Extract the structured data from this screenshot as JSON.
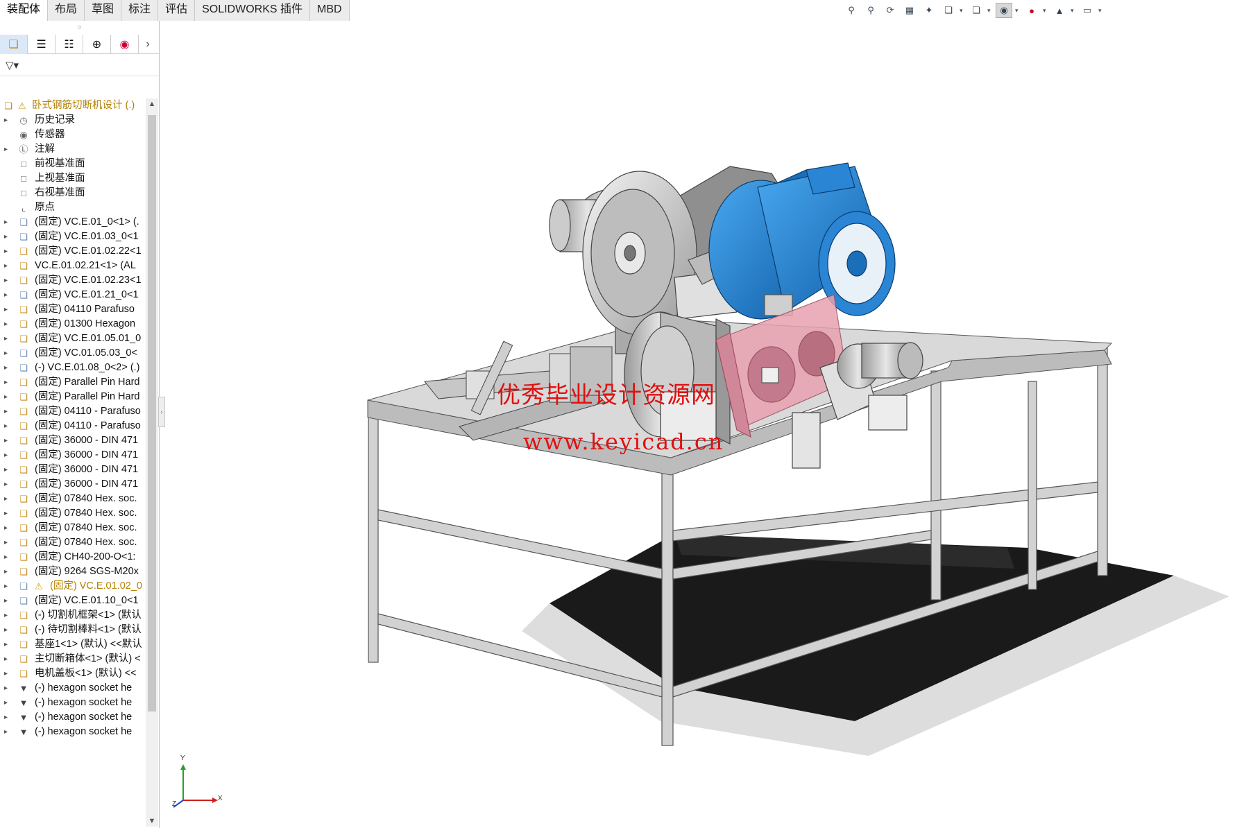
{
  "tabs": [
    {
      "label": "装配体",
      "active": true
    },
    {
      "label": "布局",
      "active": false
    },
    {
      "label": "草图",
      "active": false
    },
    {
      "label": "标注",
      "active": false
    },
    {
      "label": "评估",
      "active": false
    },
    {
      "label": "SOLIDWORKS 插件",
      "active": false
    },
    {
      "label": "MBD",
      "active": false
    }
  ],
  "hud_icons": [
    "zoom-to-fit-icon",
    "zoom-area-icon",
    "previous-view-icon",
    "section-view-icon",
    "dynamic-annotation-icon",
    "view-orientation-icon",
    "display-style-icon",
    "hide-show-icon",
    "edit-appearance-icon",
    "apply-scene-icon",
    "view-settings-icon"
  ],
  "panel_tabs": [
    "feature-manager-icon",
    "property-manager-icon",
    "configuration-manager-icon",
    "dimxpert-icon",
    "display-manager-icon"
  ],
  "tree": {
    "root_label": "卧式钢筋切断机设计 (.)",
    "items": [
      {
        "label": "历史记录",
        "icon": "history-icon",
        "arrow": true
      },
      {
        "label": "传感器",
        "icon": "sensor-icon",
        "arrow": false
      },
      {
        "label": "注解",
        "icon": "annotation-icon",
        "arrow": true
      },
      {
        "label": "前视基准面",
        "icon": "plane-icon",
        "arrow": false
      },
      {
        "label": "上视基准面",
        "icon": "plane-icon",
        "arrow": false
      },
      {
        "label": "右视基准面",
        "icon": "plane-icon",
        "arrow": false
      },
      {
        "label": "原点",
        "icon": "origin-icon",
        "arrow": false
      },
      {
        "label": "(固定) VC.E.01_0<1> (.",
        "icon": "part-icon",
        "arrow": true
      },
      {
        "label": "(固定) VC.E.01.03_0<1",
        "icon": "part-icon",
        "arrow": true
      },
      {
        "label": "(固定) VC.E.01.02.22<1",
        "icon": "assembly-icon",
        "arrow": true
      },
      {
        "label": "VC.E.01.02.21<1> (AL",
        "icon": "assembly-icon",
        "arrow": true
      },
      {
        "label": "(固定) VC.E.01.02.23<1",
        "icon": "assembly-icon",
        "arrow": true
      },
      {
        "label": "(固定) VC.E.01.21_0<1",
        "icon": "part-icon",
        "arrow": true
      },
      {
        "label": "(固定) 04110 Parafuso",
        "icon": "assembly-icon",
        "arrow": true
      },
      {
        "label": "(固定) 01300 Hexagon",
        "icon": "assembly-icon",
        "arrow": true
      },
      {
        "label": "(固定) VC.E.01.05.01_0",
        "icon": "assembly-icon",
        "arrow": true
      },
      {
        "label": "(固定) VC.01.05.03_0<",
        "icon": "part-icon",
        "arrow": true
      },
      {
        "label": "(-) VC.E.01.08_0<2> (.)",
        "icon": "part-icon",
        "arrow": true
      },
      {
        "label": "(固定) Parallel Pin Hard",
        "icon": "assembly-icon",
        "arrow": true
      },
      {
        "label": "(固定) Parallel Pin Hard",
        "icon": "assembly-icon",
        "arrow": true
      },
      {
        "label": "(固定) 04110 - Parafuso",
        "icon": "assembly-icon",
        "arrow": true
      },
      {
        "label": "(固定) 04110 - Parafuso",
        "icon": "assembly-icon",
        "arrow": true
      },
      {
        "label": "(固定) 36000 - DIN 471",
        "icon": "assembly-icon",
        "arrow": true
      },
      {
        "label": "(固定) 36000 - DIN 471",
        "icon": "assembly-icon",
        "arrow": true
      },
      {
        "label": "(固定) 36000 - DIN 471",
        "icon": "assembly-icon",
        "arrow": true
      },
      {
        "label": "(固定) 36000 - DIN 471",
        "icon": "assembly-icon",
        "arrow": true
      },
      {
        "label": "(固定) 07840 Hex. soc.",
        "icon": "assembly-icon",
        "arrow": true
      },
      {
        "label": "(固定) 07840 Hex. soc.",
        "icon": "assembly-icon",
        "arrow": true
      },
      {
        "label": "(固定) 07840 Hex. soc.",
        "icon": "assembly-icon",
        "arrow": true
      },
      {
        "label": "(固定) 07840 Hex. soc.",
        "icon": "assembly-icon",
        "arrow": true
      },
      {
        "label": "(固定) CH40-200-O<1:",
        "icon": "assembly-icon",
        "arrow": true
      },
      {
        "label": "(固定) 9264 SGS-M20x",
        "icon": "assembly-icon",
        "arrow": true
      },
      {
        "label": "(固定) VC.E.01.02_0",
        "icon": "part-icon",
        "arrow": true,
        "warning": true
      },
      {
        "label": "(固定) VC.E.01.10_0<1",
        "icon": "part-icon",
        "arrow": true
      },
      {
        "label": "(-) 切割机框架<1> (默认",
        "icon": "assembly-icon",
        "arrow": true
      },
      {
        "label": "(-) 待切割棒料<1> (默认",
        "icon": "assembly-icon",
        "arrow": true
      },
      {
        "label": "基座1<1> (默认) <<默认",
        "icon": "assembly-icon",
        "arrow": true
      },
      {
        "label": "主切断箱体<1> (默认) <",
        "icon": "assembly-icon",
        "arrow": true
      },
      {
        "label": "电机盖板<1> (默认) <<",
        "icon": "assembly-icon",
        "arrow": true
      },
      {
        "label": "(-) hexagon socket he",
        "icon": "screw-icon",
        "arrow": true
      },
      {
        "label": "(-) hexagon socket he",
        "icon": "screw-icon",
        "arrow": true
      },
      {
        "label": "(-) hexagon socket he",
        "icon": "screw-icon",
        "arrow": true
      },
      {
        "label": "(-) hexagon socket he",
        "icon": "screw-icon",
        "arrow": true
      }
    ]
  },
  "watermark": {
    "line1": "优秀毕业设计资源网",
    "line2": "www.keyicad.cn",
    "color": "#e01010"
  },
  "triad": {
    "x": "X",
    "y": "Y",
    "z": "Z"
  },
  "colors": {
    "motor_blue": "#1e7fd0",
    "guard_pink": "#e8a2b0",
    "frame_gray": "#c8c8c8"
  }
}
